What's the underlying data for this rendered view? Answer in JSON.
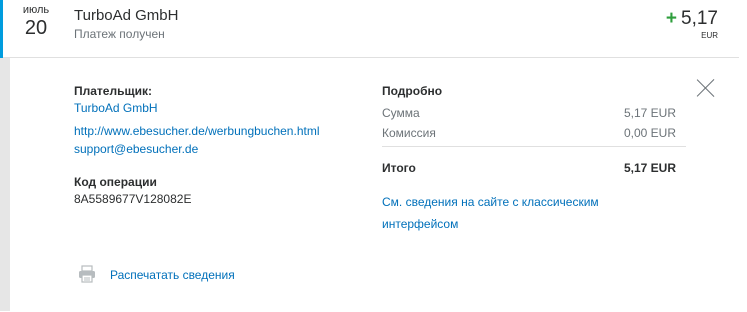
{
  "header": {
    "month": "июль",
    "day": "20",
    "merchant": "TurboAd GmbH",
    "status": "Платеж получен",
    "amount_sign": "+",
    "amount": "5,17",
    "currency": "EUR"
  },
  "payer": {
    "label": "Плательщик:",
    "name": "TurboAd GmbH",
    "website": "http://www.ebesucher.de/werbungbuchen.html",
    "email": "support@ebesucher.de"
  },
  "transaction": {
    "label": "Код операции",
    "id": "8A5589677V128082E"
  },
  "summary": {
    "title": "Подробно",
    "rows": [
      {
        "label": "Сумма",
        "value": "5,17 EUR"
      },
      {
        "label": "Комиссия",
        "value": "0,00 EUR"
      }
    ],
    "total_label": "Итого",
    "total_value": "5,17 EUR"
  },
  "classic_link": {
    "line1": "См. сведения на сайте с классическим",
    "line2": "интерфейсом"
  },
  "print": {
    "label": "Распечатать сведения",
    "icon": "printer-icon"
  },
  "close": {
    "icon": "close-icon"
  },
  "colors": {
    "accent": "#009cde",
    "link": "#0070ba",
    "positive": "#2e9e3c",
    "text": "#2c2e2f",
    "muted": "#6c7378"
  }
}
